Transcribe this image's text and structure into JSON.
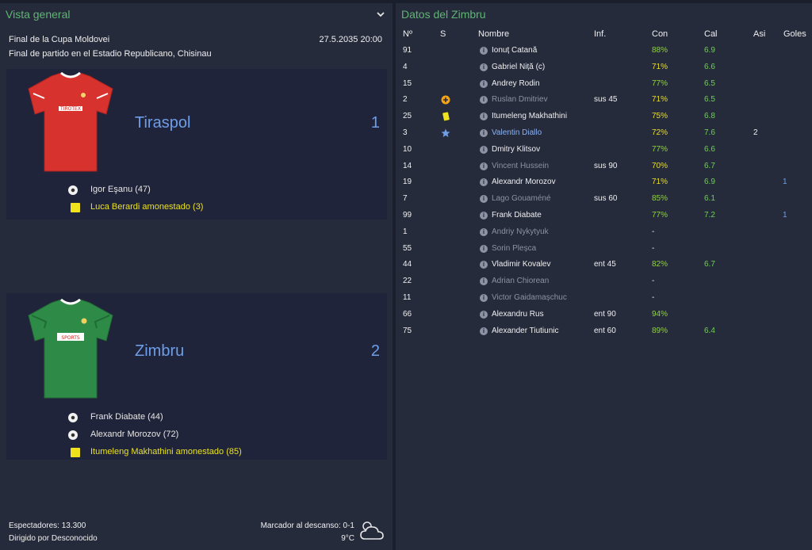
{
  "left": {
    "title": "Vista general",
    "competition": "Final de la Cupa Moldovei",
    "datetime": "27.5.2035 20:00",
    "venue": "Final de partido en el Estadio Republicano, Chisinau",
    "home": {
      "name": "Tiraspol",
      "score": "1",
      "shirt_color": "#d8322e",
      "sponsor": "TIROTEX",
      "events": [
        {
          "type": "goal",
          "text": "Igor Eşanu (47)"
        },
        {
          "type": "yellow",
          "text": "Luca Berardi amonestado (3)"
        }
      ]
    },
    "away": {
      "name": "Zimbru",
      "score": "2",
      "shirt_color": "#2e8b47",
      "sponsor": "SPORTS",
      "events": [
        {
          "type": "goal",
          "text": "Frank Diabate (44)"
        },
        {
          "type": "goal",
          "text": "Alexandr Morozov (72)"
        },
        {
          "type": "yellow",
          "text": "Itumeleng Makhathini amonestado (85)"
        }
      ]
    },
    "footer": {
      "attendance": "Espectadores: 13.300",
      "referee": "Dirigido por Desconocido",
      "halftime": "Marcador al descanso: 0-1",
      "temperature": "9°C",
      "weather_icon": "cloud-sun-icon"
    }
  },
  "right": {
    "title": "Datos del Zimbru",
    "headers": {
      "num": "Nº",
      "s": "S",
      "name": "Nombre",
      "inf": "Inf.",
      "con": "Con",
      "cal": "Cal",
      "asi": "Asi",
      "goles": "Goles"
    },
    "players": [
      {
        "num": "91",
        "s": "",
        "name": "Ionuț Catană",
        "inf": "",
        "con": "88%",
        "cal": "6.9",
        "asi": "",
        "goles": "",
        "style": "normal"
      },
      {
        "num": "4",
        "s": "",
        "name": "Gabriel Niță (c)",
        "inf": "",
        "con": "71%",
        "cal": "6.6",
        "asi": "",
        "goles": "",
        "style": "normal"
      },
      {
        "num": "15",
        "s": "",
        "name": "Andrey Rodin",
        "inf": "",
        "con": "77%",
        "cal": "6.5",
        "asi": "",
        "goles": "",
        "style": "normal"
      },
      {
        "num": "2",
        "s": "sub-icon",
        "name": "Ruslan Dmitriev",
        "inf": "sus 45",
        "con": "71%",
        "cal": "6.5",
        "asi": "",
        "goles": "",
        "style": "dim"
      },
      {
        "num": "25",
        "s": "yellow-card-icon",
        "name": "Itumeleng Makhathini",
        "inf": "",
        "con": "75%",
        "cal": "6.8",
        "asi": "",
        "goles": "",
        "style": "normal"
      },
      {
        "num": "3",
        "s": "star-icon",
        "name": "Valentin Diallo",
        "inf": "",
        "con": "72%",
        "cal": "7.6",
        "asi": "2",
        "goles": "",
        "style": "hl"
      },
      {
        "num": "10",
        "s": "",
        "name": "Dmitry Klitsov",
        "inf": "",
        "con": "77%",
        "cal": "6.6",
        "asi": "",
        "goles": "",
        "style": "normal"
      },
      {
        "num": "14",
        "s": "",
        "name": "Vincent Hussein",
        "inf": "sus 90",
        "con": "70%",
        "cal": "6.7",
        "asi": "",
        "goles": "",
        "style": "dim"
      },
      {
        "num": "19",
        "s": "",
        "name": "Alexandr Morozov",
        "inf": "",
        "con": "71%",
        "cal": "6.9",
        "asi": "",
        "goles": "1",
        "style": "normal"
      },
      {
        "num": "7",
        "s": "",
        "name": "Lago Gouaméné",
        "inf": "sus 60",
        "con": "85%",
        "cal": "6.1",
        "asi": "",
        "goles": "",
        "style": "dim"
      },
      {
        "num": "99",
        "s": "",
        "name": "Frank Diabate",
        "inf": "",
        "con": "77%",
        "cal": "7.2",
        "asi": "",
        "goles": "1",
        "style": "normal"
      },
      {
        "num": "1",
        "s": "",
        "name": "Andriy Nykytyuk",
        "inf": "",
        "con": "-",
        "cal": "",
        "asi": "",
        "goles": "",
        "style": "dim"
      },
      {
        "num": "55",
        "s": "",
        "name": "Sorin Pleșca",
        "inf": "",
        "con": "-",
        "cal": "",
        "asi": "",
        "goles": "",
        "style": "dim"
      },
      {
        "num": "44",
        "s": "",
        "name": "Vladimir Kovalev",
        "inf": "ent 45",
        "con": "82%",
        "cal": "6.7",
        "asi": "",
        "goles": "",
        "style": "normal"
      },
      {
        "num": "22",
        "s": "",
        "name": "Adrian Chiorean",
        "inf": "",
        "con": "-",
        "cal": "",
        "asi": "",
        "goles": "",
        "style": "dim"
      },
      {
        "num": "11",
        "s": "",
        "name": "Victor Gaidamașchuc",
        "inf": "",
        "con": "-",
        "cal": "",
        "asi": "",
        "goles": "",
        "style": "dim"
      },
      {
        "num": "66",
        "s": "",
        "name": "Alexandru Rus",
        "inf": "ent 90",
        "con": "94%",
        "cal": "",
        "asi": "",
        "goles": "",
        "style": "normal"
      },
      {
        "num": "75",
        "s": "",
        "name": "Alexander Tiutiunic",
        "inf": "ent 60",
        "con": "89%",
        "cal": "6.4",
        "asi": "",
        "goles": "",
        "style": "normal"
      }
    ]
  }
}
